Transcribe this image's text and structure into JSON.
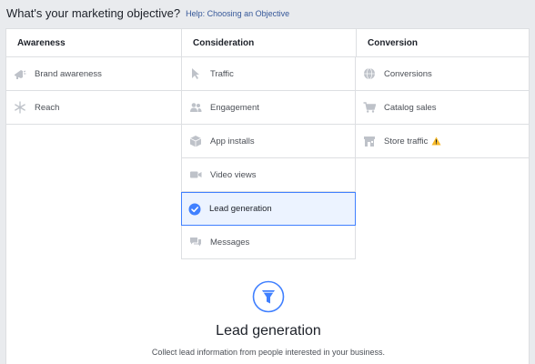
{
  "header": {
    "title": "What's your marketing objective?",
    "help_link": "Help: Choosing an Objective"
  },
  "columns": {
    "awareness": {
      "title": "Awareness",
      "items": [
        {
          "label": "Brand awareness",
          "icon": "megaphone-icon"
        },
        {
          "label": "Reach",
          "icon": "snowflake-icon"
        }
      ]
    },
    "consideration": {
      "title": "Consideration",
      "items": [
        {
          "label": "Traffic",
          "icon": "cursor-icon"
        },
        {
          "label": "Engagement",
          "icon": "people-icon"
        },
        {
          "label": "App installs",
          "icon": "box-icon"
        },
        {
          "label": "Video views",
          "icon": "video-camera-icon"
        },
        {
          "label": "Lead generation",
          "icon": "checkmark-circle-icon",
          "selected": true
        },
        {
          "label": "Messages",
          "icon": "chat-bubbles-icon"
        }
      ]
    },
    "conversion": {
      "title": "Conversion",
      "items": [
        {
          "label": "Conversions",
          "icon": "globe-icon"
        },
        {
          "label": "Catalog sales",
          "icon": "shopping-cart-icon"
        },
        {
          "label": "Store traffic",
          "icon": "store-icon",
          "warning": true
        }
      ]
    }
  },
  "detail": {
    "icon": "funnel-icon",
    "title": "Lead generation",
    "description": "Collect lead information from people interested in your business."
  },
  "colors": {
    "accent": "#4080ff",
    "selected_bg": "#ecf3ff",
    "icon_gray": "#bec2c9",
    "warning": "#f7b928",
    "link": "#365899"
  }
}
